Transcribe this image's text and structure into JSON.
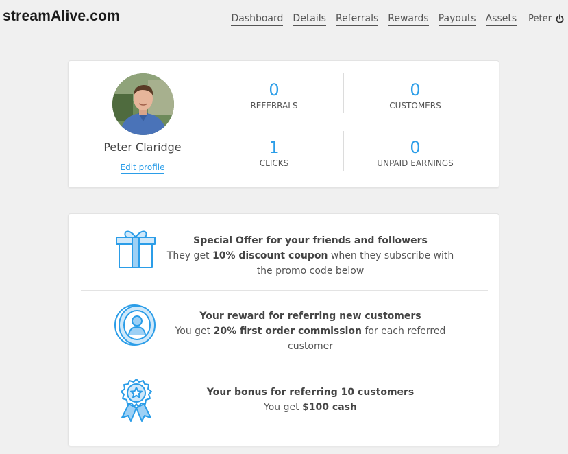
{
  "header": {
    "logo_text": "streamAlive.com",
    "nav": [
      "Dashboard",
      "Details",
      "Referrals",
      "Rewards",
      "Payouts",
      "Assets"
    ],
    "user_name": "Peter",
    "logout_icon": "power-icon"
  },
  "profile": {
    "name": "Peter Claridge",
    "edit_label": "Edit profile",
    "avatar_icon": "user-photo"
  },
  "stats": [
    {
      "value": "0",
      "label": "REFERRALS"
    },
    {
      "value": "0",
      "label": "CUSTOMERS"
    },
    {
      "value": "1",
      "label": "CLICKS"
    },
    {
      "value": "0",
      "label": "UNPAID EARNINGS"
    }
  ],
  "offers": [
    {
      "icon": "gift-icon",
      "title": "Special Offer for your friends and followers",
      "pre": "They get ",
      "bold": "10% discount coupon",
      "post": " when they subscribe with the promo code below"
    },
    {
      "icon": "coin-icon",
      "title": "Your reward for referring new customers",
      "pre": "You get ",
      "bold": "20% first order commission",
      "post": " for each referred customer"
    },
    {
      "icon": "award-badge-icon",
      "title": "Your bonus for referring 10 customers",
      "pre": "You get ",
      "bold": "$100 cash",
      "post": ""
    }
  ],
  "colors": {
    "accent": "#2b9de8",
    "background": "#f0f0f0",
    "card": "#ffffff"
  }
}
